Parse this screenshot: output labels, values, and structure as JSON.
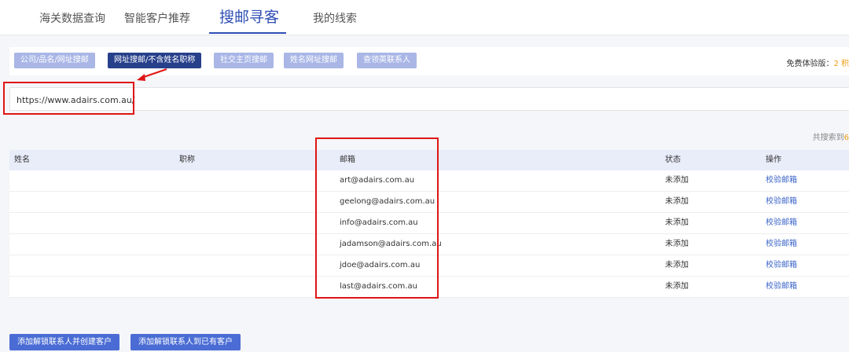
{
  "tabs": [
    {
      "label": "海关数据查询"
    },
    {
      "label": "智能客户推荐"
    },
    {
      "label": "搜邮寻客"
    },
    {
      "label": "我的线索"
    }
  ],
  "search_modes": [
    {
      "label": "公司/品名/网址搜邮"
    },
    {
      "label": "网址搜邮/不含姓名职称"
    },
    {
      "label": "社交主页搜邮"
    },
    {
      "label": "姓名网址搜邮"
    },
    {
      "label": "查领英联系人"
    }
  ],
  "trial": {
    "label": "免费体验版：",
    "value": "2 积"
  },
  "url_input": {
    "value": "https://www.adairs.com.au/"
  },
  "result_count": {
    "label": "共搜索到",
    "value": "6"
  },
  "table": {
    "headers": {
      "name": "姓名",
      "title": "职称",
      "email": "邮箱",
      "status": "状态",
      "action": "操作"
    },
    "rows": [
      {
        "name": "",
        "title": "",
        "email": "art@adairs.com.au",
        "status": "未添加",
        "action": "校验邮箱"
      },
      {
        "name": "",
        "title": "",
        "email": "geelong@adairs.com.au",
        "status": "未添加",
        "action": "校验邮箱"
      },
      {
        "name": "",
        "title": "",
        "email": "info@adairs.com.au",
        "status": "未添加",
        "action": "校验邮箱"
      },
      {
        "name": "",
        "title": "",
        "email": "jadamson@adairs.com.au",
        "status": "未添加",
        "action": "校验邮箱"
      },
      {
        "name": "",
        "title": "",
        "email": "jdoe@adairs.com.au",
        "status": "未添加",
        "action": "校验邮箱"
      },
      {
        "name": "",
        "title": "",
        "email": "last@adairs.com.au",
        "status": "未添加",
        "action": "校验邮箱"
      }
    ]
  },
  "buttons": {
    "add_new": "添加解锁联系人并创建客户",
    "add_existing": "添加解锁联系人到已有客户"
  },
  "colors": {
    "accent": "#2f4fb5",
    "highlight": "#e01515",
    "warning": "#f39c12"
  }
}
